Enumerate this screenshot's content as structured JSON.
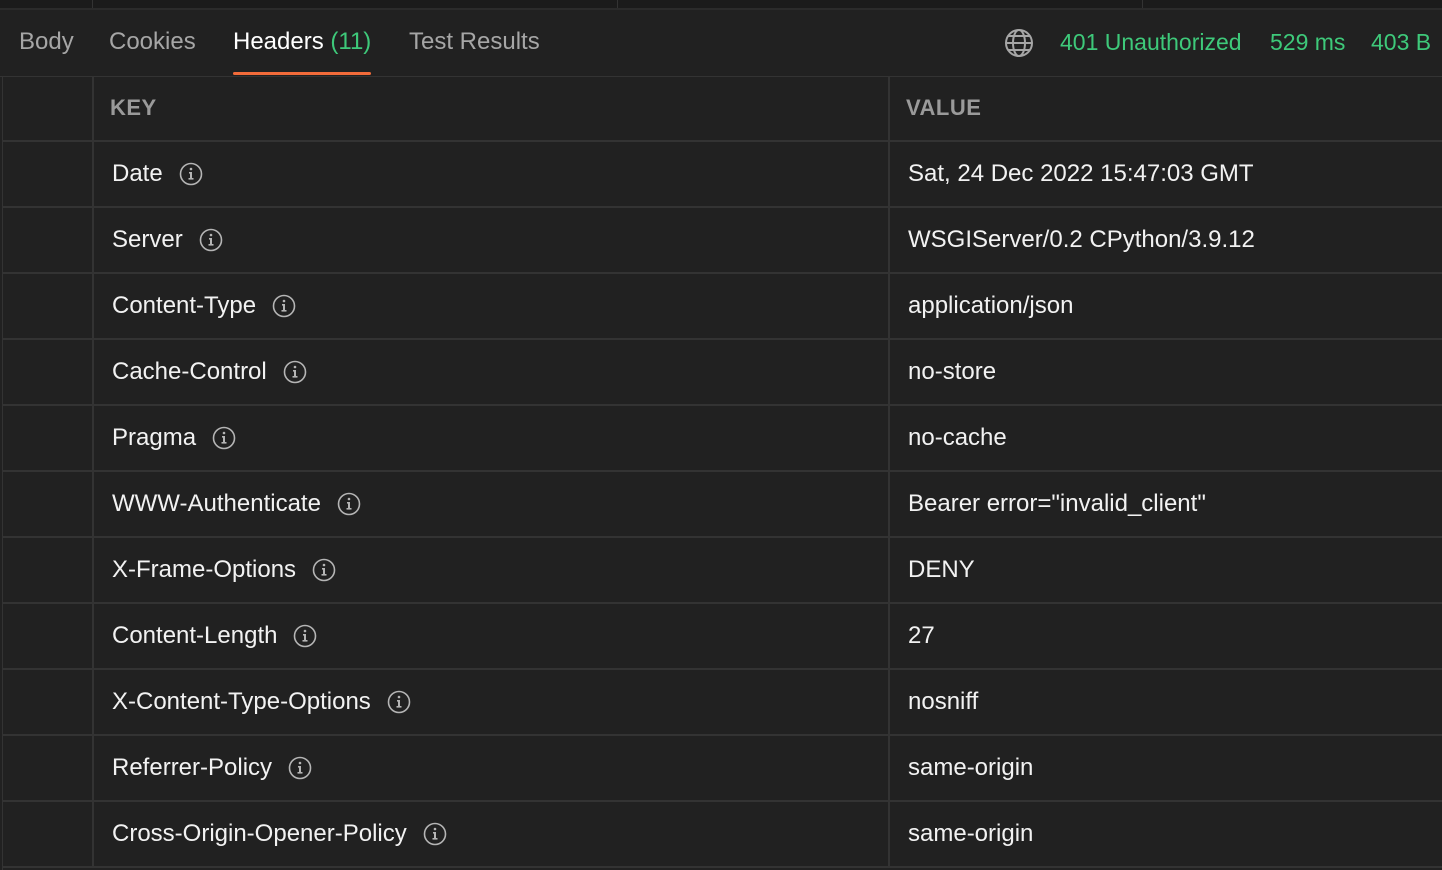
{
  "tabs": [
    {
      "label": "Body",
      "count": ""
    },
    {
      "label": "Cookies",
      "count": ""
    },
    {
      "label": "Headers",
      "count": "(11)"
    },
    {
      "label": "Test Results",
      "count": ""
    }
  ],
  "active_tab": "Headers",
  "response_meta": {
    "status": "401 Unauthorized",
    "time": "529 ms",
    "size": "403 B"
  },
  "table": {
    "key_header": "KEY",
    "value_header": "VALUE",
    "rows": [
      {
        "key": "Date",
        "value": "Sat, 24 Dec 2022 15:47:03 GMT"
      },
      {
        "key": "Server",
        "value": "WSGIServer/0.2 CPython/3.9.12"
      },
      {
        "key": "Content-Type",
        "value": "application/json"
      },
      {
        "key": "Cache-Control",
        "value": "no-store"
      },
      {
        "key": "Pragma",
        "value": "no-cache"
      },
      {
        "key": "WWW-Authenticate",
        "value": "Bearer error=\"invalid_client\""
      },
      {
        "key": "X-Frame-Options",
        "value": "DENY"
      },
      {
        "key": "Content-Length",
        "value": "27"
      },
      {
        "key": "X-Content-Type-Options",
        "value": "nosniff"
      },
      {
        "key": "Referrer-Policy",
        "value": "same-origin"
      },
      {
        "key": "Cross-Origin-Opener-Policy",
        "value": "same-origin"
      }
    ]
  },
  "colors": {
    "background": "#212121",
    "accent_tab_underline": "#f26b3a",
    "status_green": "#3ec97a",
    "grid_line": "#333333"
  },
  "icons": {
    "network": "globe-icon",
    "row_info": "info-icon"
  }
}
